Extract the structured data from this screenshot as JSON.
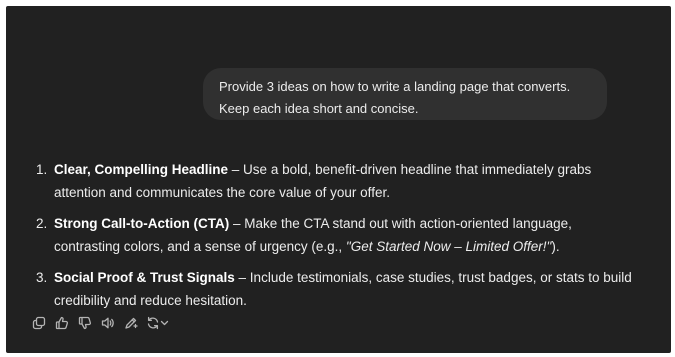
{
  "user_message": {
    "line1": "Provide 3 ideas on how to write a landing page that converts.",
    "line2": "Keep each idea short and concise."
  },
  "response": {
    "items": [
      {
        "number": "1.",
        "title": "Clear, Compelling Headline",
        "line1_rest": " – Use a bold, benefit-driven headline that immediately grabs",
        "line2": "attention and communicates the core value of your offer."
      },
      {
        "number": "2.",
        "title": "Strong Call-to-Action (CTA)",
        "line1_rest": " – Make the CTA stand out with action-oriented language,",
        "line2_before": "contrasting colors, and a sense of urgency (e.g., ",
        "line2_italic": "\"Get Started Now – Limited Offer!\"",
        "line2_after": ")."
      },
      {
        "number": "3.",
        "title": "Social Proof & Trust Signals",
        "line1_rest": " – Include testimonials, case studies, trust badges, or stats to build",
        "line2": "credibility and reduce hesitation."
      }
    ]
  },
  "actions": [
    {
      "name": "copy",
      "icon": "copy-icon"
    },
    {
      "name": "good-response",
      "icon": "thumbs-up-icon"
    },
    {
      "name": "bad-response",
      "icon": "thumbs-down-icon"
    },
    {
      "name": "read-aloud",
      "icon": "speaker-icon"
    },
    {
      "name": "edit-in-canvas",
      "icon": "pen-sparkle-icon"
    },
    {
      "name": "regenerate",
      "icon": "refresh-chevron-icon"
    }
  ],
  "colors": {
    "background": "#212121",
    "bubble": "#303030",
    "text": "#ececec",
    "icon": "#b4b4b4"
  }
}
